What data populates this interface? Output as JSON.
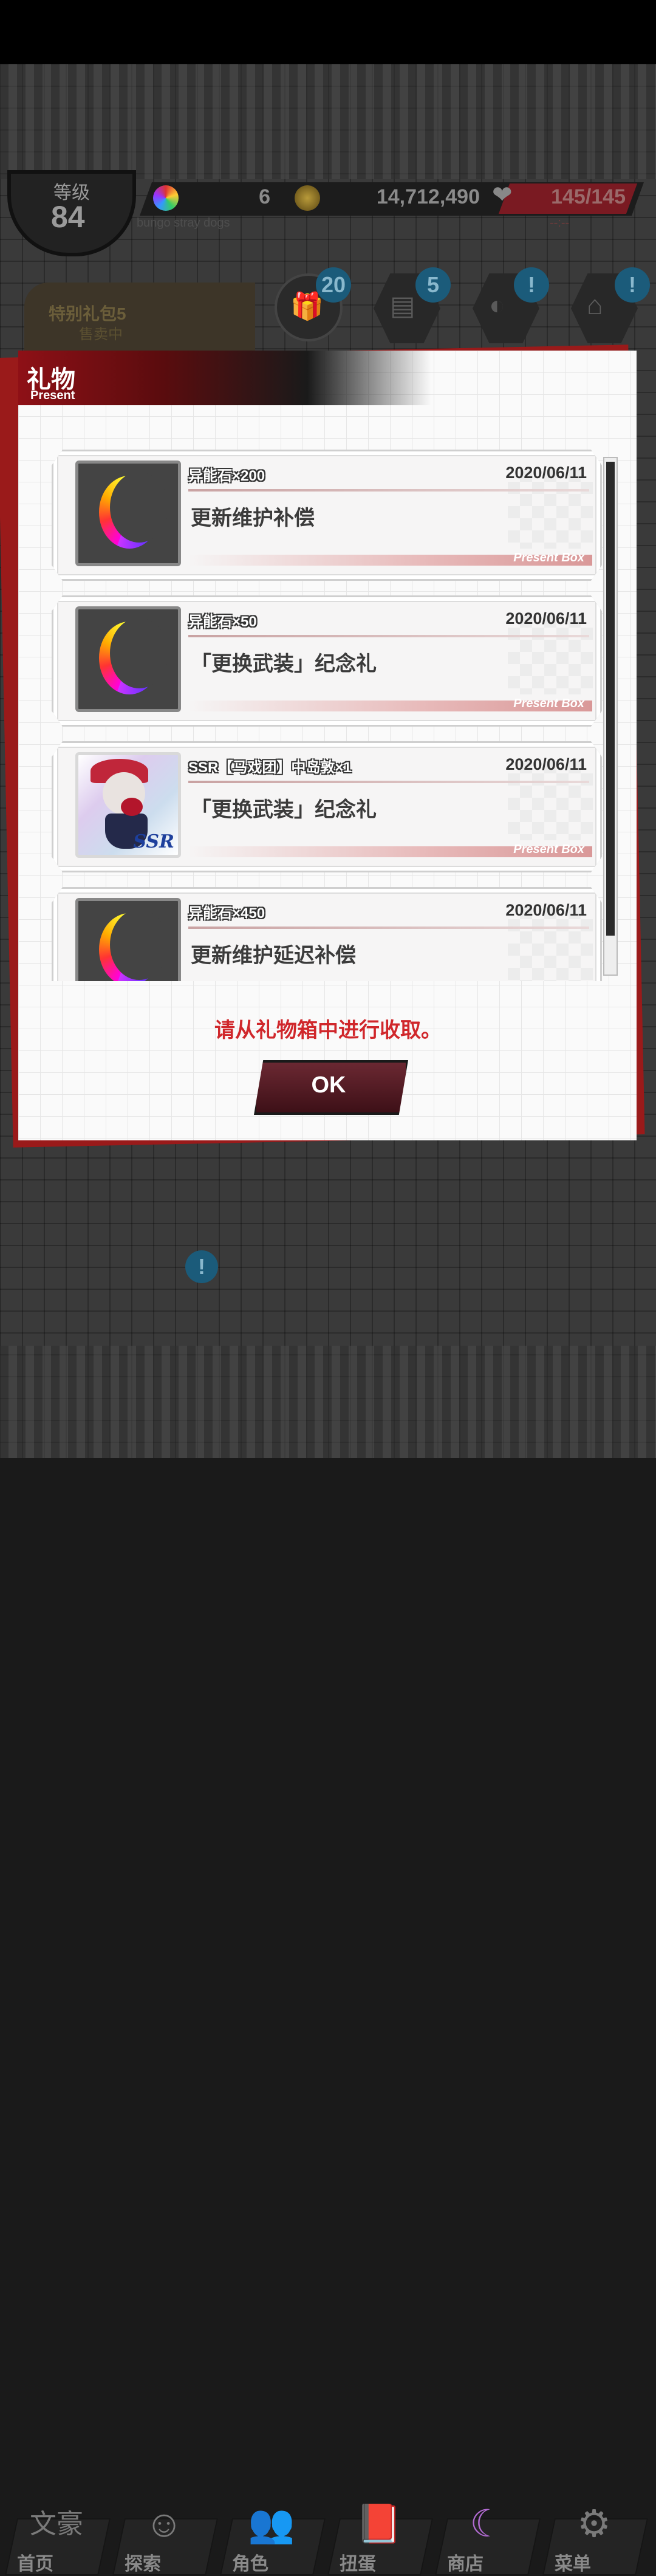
{
  "header": {
    "level_label": "等级",
    "level_value": "84",
    "stones": "6",
    "coins": "14,712,490",
    "hp": "145/145",
    "subtitle": "bungo stray dogs",
    "timer": "--:--"
  },
  "banner": {
    "title": "特别礼包5",
    "subtitle": "售卖中"
  },
  "top_icons": [
    {
      "name": "gift",
      "badge": "20"
    },
    {
      "name": "mission",
      "badge": "5"
    },
    {
      "name": "event",
      "badge": "!"
    },
    {
      "name": "building",
      "badge": "!"
    }
  ],
  "modal": {
    "title": "礼物",
    "subtitle": "Present",
    "notice": "请从礼物箱中进行收取。",
    "ok_label": "OK",
    "footer_label": "Present Box",
    "items": [
      {
        "name": "异能石×200",
        "date": "2020/06/11",
        "desc": "更新维护补偿",
        "icon": "stone"
      },
      {
        "name": "异能石×50",
        "date": "2020/06/11",
        "desc": "「更换武装」纪念礼",
        "icon": "stone"
      },
      {
        "name": "SSR【马戏团】中岛敦×1",
        "date": "2020/06/11",
        "desc": "「更换武装」纪念礼",
        "icon": "ssr-card",
        "rarity": "SSR"
      },
      {
        "name": "异能石×450",
        "date": "2020/06/11",
        "desc": "更新维护延迟补偿",
        "icon": "stone"
      }
    ]
  },
  "bottom_nav": [
    {
      "label": "首页",
      "icon": "文豪"
    },
    {
      "label": "探索",
      "icon": "explore",
      "badge": "!"
    },
    {
      "label": "角色",
      "icon": "characters"
    },
    {
      "label": "扭蛋",
      "icon": "gacha"
    },
    {
      "label": "商店",
      "icon": "shop"
    },
    {
      "label": "菜单",
      "icon": "gear"
    }
  ]
}
